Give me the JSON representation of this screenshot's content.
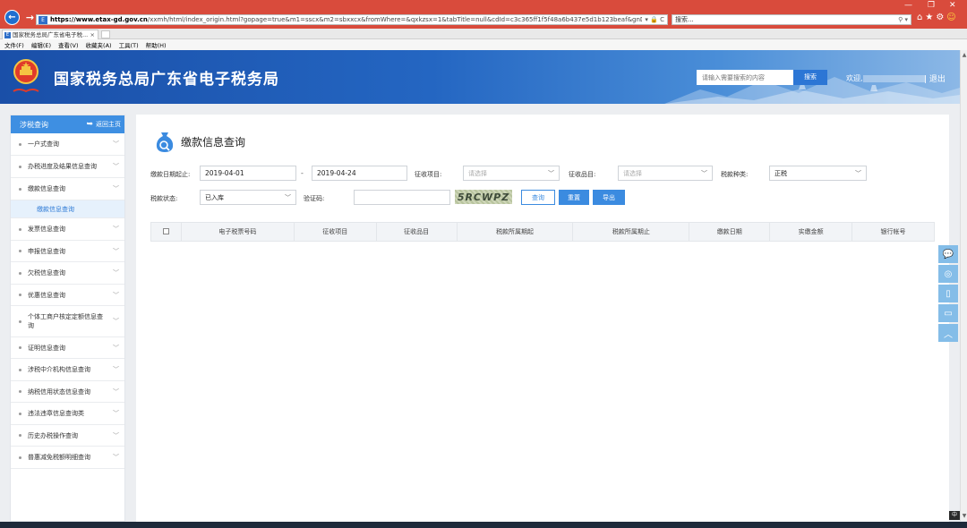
{
  "browser": {
    "url_domain": "https://www.etax-gd.gov.cn",
    "url_path": "/xxmh/html/index_origin.html?gopage=true&m1=sscx&m2=sbxxcx&fromWhere=&qxkzsx=1&tabTitle=null&cdId=c3c365ff1f5f48a6b437e5d1b123beaf&gnDm=gndm-sbxxcx#",
    "address_icons": "▾ 🔒 C",
    "search_text": "搜索...",
    "tab_title": "国家税务总局广东省电子税...",
    "tab_favicon": "E",
    "menu": [
      "文件(F)",
      "编辑(E)",
      "查看(V)",
      "收藏夹(A)",
      "工具(T)",
      "帮助(H)"
    ]
  },
  "header": {
    "title": "国家税务总局广东省电子税务局",
    "search_placeholder": "请输入需要搜索的内容",
    "search_button": "搜索",
    "welcome": "欢迎,",
    "logout": "| 退出"
  },
  "sidebar": {
    "title": "涉税查询",
    "back_label": "返回主页",
    "items": [
      {
        "label": "一户式查询"
      },
      {
        "label": "办税进度及结果信息查询"
      },
      {
        "label": "缴款信息查询"
      },
      {
        "label": "发票信息查询"
      },
      {
        "label": "申报信息查询"
      },
      {
        "label": "欠税信息查询"
      },
      {
        "label": "优惠信息查询"
      },
      {
        "label": "个体工商户核定定额信息查询"
      },
      {
        "label": "证明信息查询"
      },
      {
        "label": "涉税中介机构信息查询"
      },
      {
        "label": "纳税信用状态信息查询"
      },
      {
        "label": "违法违章信息查询类"
      },
      {
        "label": "历史办税操作查询"
      },
      {
        "label": "普惠减免税额明细查询"
      }
    ],
    "active_sub": "缴款信息查询"
  },
  "main": {
    "page_title": "缴款信息查询",
    "form": {
      "date_label": "缴款日期起止:",
      "date_from": "2019-04-01",
      "date_sep": "-",
      "date_to": "2019-04-24",
      "item_label": "征收项目:",
      "item_placeholder": "请选择",
      "sub_label": "征收品目:",
      "sub_placeholder": "请选择",
      "type_label": "税款种类:",
      "type_value": "正税",
      "status_label": "税款状态:",
      "status_value": "已入库",
      "captcha_label": "验证码:",
      "captcha_value": "",
      "captcha_text": "5RCWPZ"
    },
    "buttons": {
      "query": "查询",
      "reset": "重置",
      "export": "导出"
    },
    "table": {
      "columns": [
        "电子税票号码",
        "征收项目",
        "征收品目",
        "税款所属期起",
        "税款所属期止",
        "缴款日期",
        "实缴金额",
        "银行帐号"
      ]
    }
  },
  "colors": {
    "accent": "#3b8be0",
    "header_bg": "#1a4fa8",
    "browser_chrome": "#d94b3c"
  }
}
